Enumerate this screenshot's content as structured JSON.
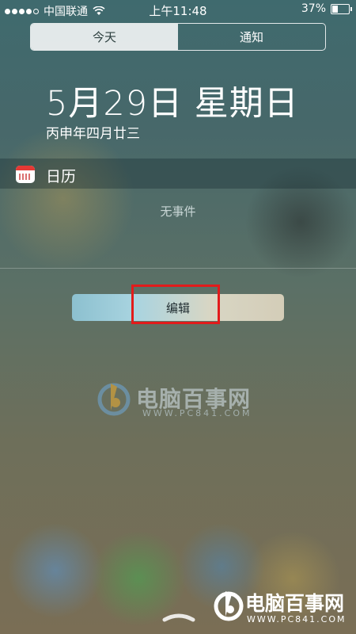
{
  "status_bar": {
    "carrier": "中国联通",
    "time": "上午11:48",
    "battery": "37%",
    "battery_level": 0.37,
    "signal_bars_filled": 4,
    "signal_bars_total": 5
  },
  "segmented_control": {
    "tabs": [
      {
        "label": "今天",
        "selected": true
      },
      {
        "label": "通知",
        "selected": false
      }
    ]
  },
  "date_header": {
    "date": "5月29日 星期日",
    "lunar": "丙申年四月廿三"
  },
  "calendar_widget": {
    "title": "日历",
    "icon": "calendar-icon",
    "empty_text": "无事件"
  },
  "edit_button": {
    "label": "编辑"
  },
  "watermark_center": {
    "name": "电脑百事网",
    "url": "WWW.PC841.COM"
  },
  "watermark_corner": {
    "name": "电脑百事网",
    "url": "WWW.PC841.COM"
  },
  "colors": {
    "highlight": "#e21b1b",
    "calendar_red": "#e53935"
  }
}
